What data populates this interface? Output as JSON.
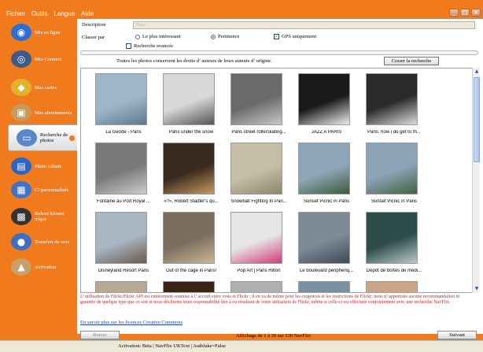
{
  "menu": [
    "Fichier",
    "Outils",
    "Langue",
    "Aide"
  ],
  "window_controls": [
    "_",
    "□",
    "×"
  ],
  "sidebar": [
    {
      "label": "Mis en ligne",
      "icon": "globe-icon",
      "color": "#2b6fd6",
      "glyph": "◉"
    },
    {
      "label": "Mio Connect",
      "icon": "connect-icon",
      "color": "#3d5a8a",
      "glyph": "◎"
    },
    {
      "label": "Mes cartes",
      "icon": "map-icon",
      "color": "#e0b22d",
      "glyph": "◆"
    },
    {
      "label": "Mes abonnements",
      "icon": "subscriptions-icon",
      "color": "#c79b5d",
      "glyph": "▣"
    },
    {
      "label": "Recherche de photos",
      "icon": "search-photos-icon",
      "color": "#5a87c9",
      "glyph": "▭"
    },
    {
      "label": "Photo Album",
      "icon": "photo-album-icon",
      "color": "#2c66c4",
      "glyph": "▤"
    },
    {
      "label": "CI personnalisés",
      "icon": "custom-poi-icon",
      "color": "#3f73c7",
      "glyph": "▦"
    },
    {
      "label": "Relevé kilomé trique",
      "icon": "odometer-icon",
      "color": "#333333",
      "glyph": "▩"
    },
    {
      "label": "Transfert de voix",
      "icon": "voice-icon",
      "color": "#3d6fc4",
      "glyph": "●"
    },
    {
      "label": "Activation",
      "icon": "activation-icon",
      "color": "#c7a06a",
      "glyph": "▲"
    }
  ],
  "form": {
    "description_label": "Description",
    "description_value": "Paris",
    "sort_label": "Classer par",
    "sort_options": [
      "Le plus intéressant",
      "Pertinence"
    ],
    "sort_selected": "Pertinence",
    "gps_label": "GPS uniquement",
    "gps_checked": true,
    "advanced_label": "Recherche avancée",
    "copyright_notice": "Toutes les photos conservent les droits d’ auteurs de leurs auteurs d’ origine.",
    "stop_button": "Cesser la recherche"
  },
  "photos": [
    {
      "caption": "La Geode - Paris",
      "bg": "#9fb6c9",
      "fg": "#5c7a8c"
    },
    {
      "caption": "Paris under the snow",
      "bg": "#d8d8d8",
      "fg": "#555555"
    },
    {
      "caption": "Paris street rollerskating...",
      "bg": "#6a6a6a",
      "fg": "#c8c8c8"
    },
    {
      "caption": "JAZZ A PARIS",
      "bg": "#1a1a1a",
      "fg": "#eeeeee"
    },
    {
      "caption": "Paris: how i do get to th...",
      "bg": "#2a2a2a",
      "fg": "#dddddd"
    },
    {
      "caption": "Fontaine au Port Royal ...",
      "bg": "#7a7a7a",
      "fg": "#cccccc"
    },
    {
      "caption": "«?», Robert Stadler's qu...",
      "bg": "#3b2a1e",
      "fg": "#c79a5e"
    },
    {
      "caption": "Snowball Fighting In Pari...",
      "bg": "#c6bfa8",
      "fg": "#8e8570"
    },
    {
      "caption": "Sunset Picnic in Paris",
      "bg": "#8fa6b8",
      "fg": "#3f5a3a"
    },
    {
      "caption": "Sunset Picnic in Paris",
      "bg": "#8ea3b6",
      "fg": "#43603f"
    },
    {
      "caption": "Disneyland Resort Paris",
      "bg": "#a9b7c4",
      "fg": "#6a5a4a"
    },
    {
      "caption": "Out of the cage in Paris!",
      "bg": "#7c6e5e",
      "fg": "#c9b796"
    },
    {
      "caption": "Pop Art | Paris Hilton",
      "bg": "#e6e6e6",
      "fg": "#d43a7a"
    },
    {
      "caption": "Le boulevard périphériq...",
      "bg": "#7e8a95",
      "fg": "#3e4a55"
    },
    {
      "caption": "Dépôt de boîtes de médi...",
      "bg": "#2e4c4a",
      "fg": "#b8c9c8"
    },
    {
      "caption": "",
      "bg": "#b8a898",
      "fg": "#6a5a4a"
    },
    {
      "caption": "",
      "bg": "#3a2418",
      "fg": "#c46a2a"
    },
    {
      "caption": "",
      "bg": "#b0b0b0",
      "fg": "#5a4a3a"
    },
    {
      "caption": "",
      "bg": "#7a8fa0",
      "fg": "#aaaaaa"
    },
    {
      "caption": "",
      "bg": "#c9a488",
      "fg": "#6a4a3a"
    }
  ],
  "disclaimer": "L’ utilisation de Flickr/Flickr API est entièrement soumise à l’ accord entre vous et Flickr ; il en va de même pour les exigences et les restrictions de Flickr; nous n’ apportons aucune recommandation ni garantie de quelque type que ce soit et nous déclinons toute responsabilité liée à ou résultant de votre utilisation de Flickr, même si celle-ci est effectuée conjointement avec une recherche NavFlix.",
  "cc_link": "En savoir plus sur les licences Creative Commons",
  "nav": {
    "back": "Retour",
    "next": "Suivant",
    "page_info": "Affichage de 1 à 30 sur 130 NavFlix"
  },
  "status": "Activation: Beta | NavFlix UKText | Authfake=False"
}
